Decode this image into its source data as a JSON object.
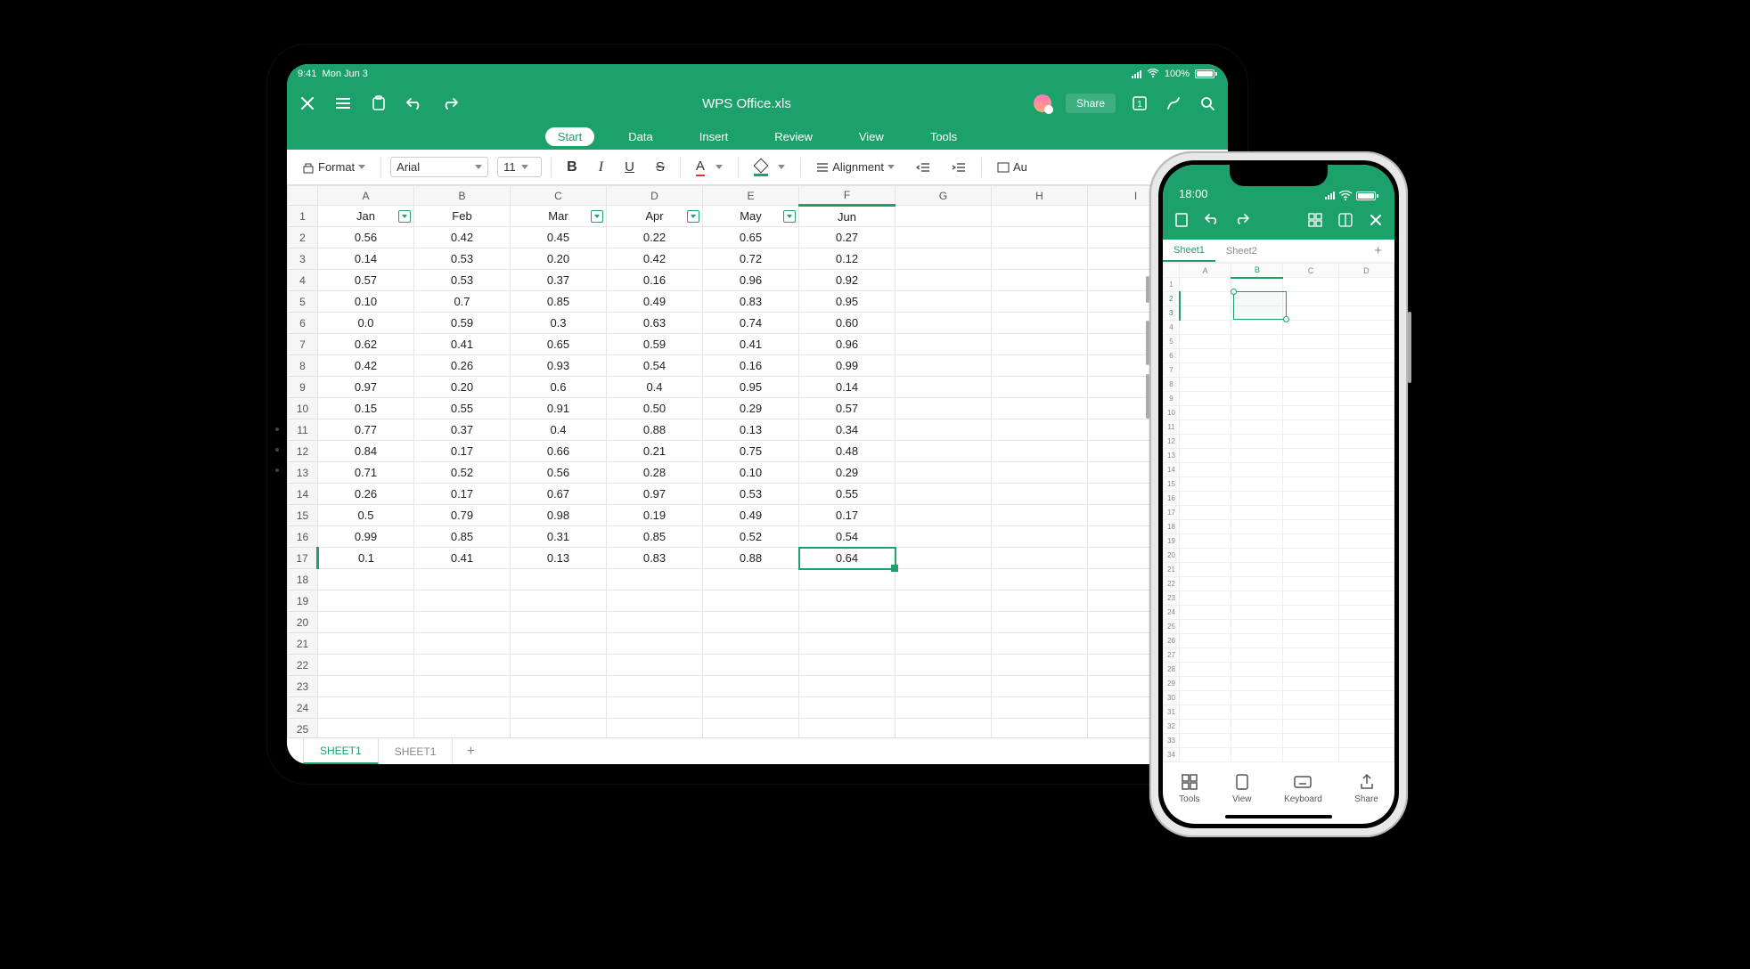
{
  "tablet": {
    "status": {
      "time": "9:41",
      "date": "Mon Jun 3",
      "battery": "100%"
    },
    "title": "WPS Office.xls",
    "share_label": "Share",
    "ribbon": [
      "Start",
      "Data",
      "Insert",
      "Review",
      "View",
      "Tools"
    ],
    "ribbon_active": 0,
    "toolbar": {
      "format_label": "Format",
      "font_name": "Arial",
      "font_size": "11",
      "alignment_label": "Alignment",
      "auto_label": "Au"
    },
    "columns": [
      "A",
      "B",
      "C",
      "D",
      "E",
      "F",
      "G",
      "H",
      "I"
    ],
    "row_count": 25,
    "headers": [
      "Jan",
      "Feb",
      "Mar",
      "Apr",
      "May",
      "Jun"
    ],
    "filter_cols": [
      0,
      2,
      3,
      4
    ],
    "rows": [
      [
        "0.56",
        "0.42",
        "0.45",
        "0.22",
        "0.65",
        "0.27"
      ],
      [
        "0.14",
        "0.53",
        "0.20",
        "0.42",
        "0.72",
        "0.12"
      ],
      [
        "0.57",
        "0.53",
        "0.37",
        "0.16",
        "0.96",
        "0.92"
      ],
      [
        "0.10",
        "0.7",
        "0.85",
        "0.49",
        "0.83",
        "0.95"
      ],
      [
        "0.0",
        "0.59",
        "0.3",
        "0.63",
        "0.74",
        "0.60"
      ],
      [
        "0.62",
        "0.41",
        "0.65",
        "0.59",
        "0.41",
        "0.96"
      ],
      [
        "0.42",
        "0.26",
        "0.93",
        "0.54",
        "0.16",
        "0.99"
      ],
      [
        "0.97",
        "0.20",
        "0.6",
        "0.4",
        "0.95",
        "0.14"
      ],
      [
        "0.15",
        "0.55",
        "0.91",
        "0.50",
        "0.29",
        "0.57"
      ],
      [
        "0.77",
        "0.37",
        "0.4",
        "0.88",
        "0.13",
        "0.34"
      ],
      [
        "0.84",
        "0.17",
        "0.66",
        "0.21",
        "0.75",
        "0.48"
      ],
      [
        "0.71",
        "0.52",
        "0.56",
        "0.28",
        "0.10",
        "0.29"
      ],
      [
        "0.26",
        "0.17",
        "0.67",
        "0.97",
        "0.53",
        "0.55"
      ],
      [
        "0.5",
        "0.79",
        "0.98",
        "0.19",
        "0.49",
        "0.17"
      ],
      [
        "0.99",
        "0.85",
        "0.31",
        "0.85",
        "0.52",
        "0.54"
      ],
      [
        "0.1",
        "0.41",
        "0.13",
        "0.83",
        "0.88",
        "0.64"
      ]
    ],
    "selected": {
      "row": 17,
      "col": "F"
    },
    "sheet_tabs": [
      "SHEET1",
      "SHEET1"
    ]
  },
  "phone": {
    "status": {
      "time": "18:00"
    },
    "sheet_tabs": [
      "Sheet1",
      "Sheet2"
    ],
    "columns": [
      "A",
      "B",
      "C",
      "D"
    ],
    "row_count": 38,
    "selected_rows": [
      2,
      3
    ],
    "selected_col": "B",
    "bottom": [
      {
        "label": "Tools",
        "icon": "grid"
      },
      {
        "label": "View",
        "icon": "device"
      },
      {
        "label": "Keyboard",
        "icon": "keyboard"
      },
      {
        "label": "Share",
        "icon": "share"
      }
    ]
  }
}
